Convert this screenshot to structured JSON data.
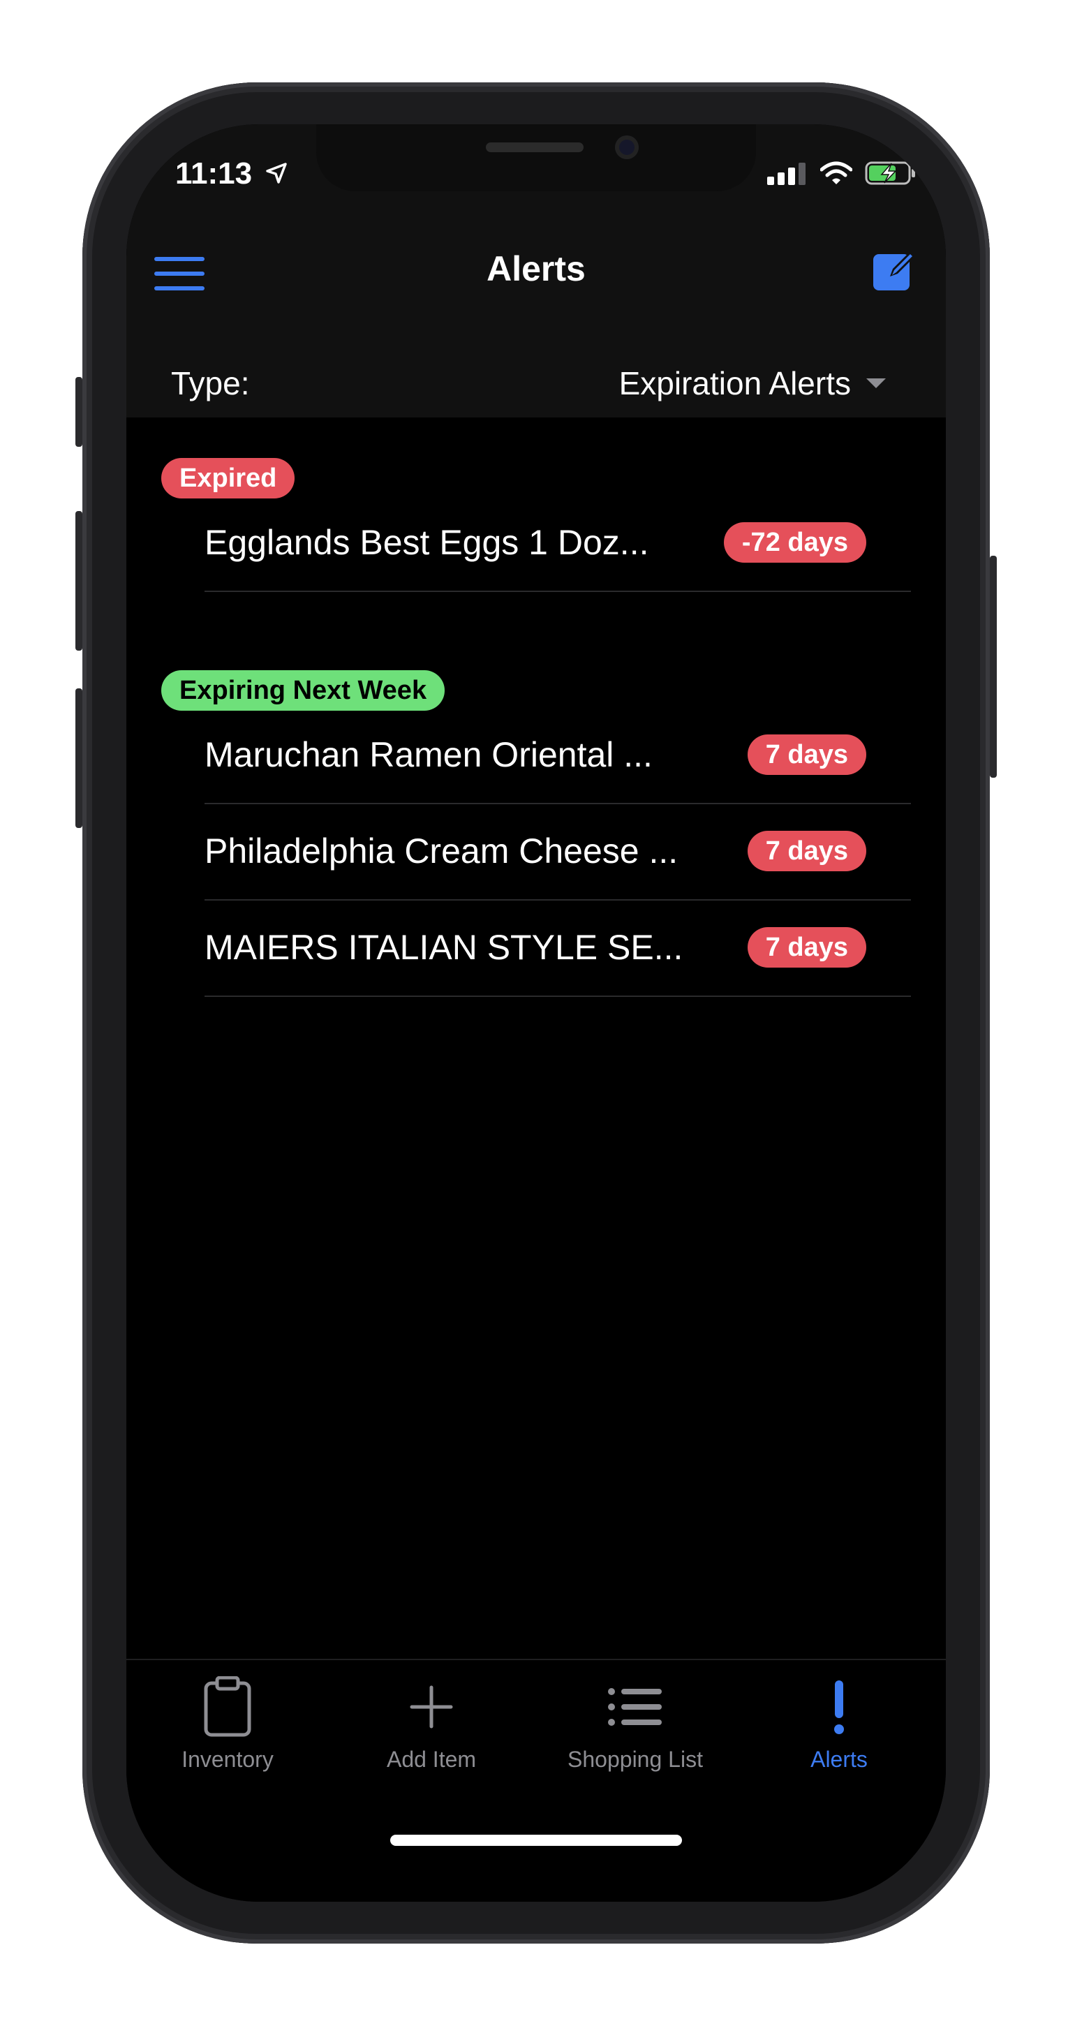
{
  "status_bar": {
    "time": "11:13"
  },
  "nav": {
    "title": "Alerts"
  },
  "filter": {
    "type_label": "Type:",
    "selected_value": "Expiration Alerts"
  },
  "sections": {
    "expired": {
      "label": "Expired",
      "color": "#e5505a",
      "items": [
        {
          "name": "Egglands Best Eggs 1 Doz...",
          "days": "-72 days"
        }
      ]
    },
    "next_week": {
      "label": "Expiring Next Week",
      "color": "#6ee07a",
      "items": [
        {
          "name": "Maruchan Ramen Oriental ...",
          "days": "7 days"
        },
        {
          "name": "Philadelphia Cream Cheese ...",
          "days": "7 days"
        },
        {
          "name": "MAIERS ITALIAN STYLE SE...",
          "days": "7 days"
        }
      ]
    }
  },
  "tabs": [
    {
      "label": "Inventory",
      "icon": "clipboard-icon"
    },
    {
      "label": "Add Item",
      "icon": "plus-icon"
    },
    {
      "label": "Shopping List",
      "icon": "list-icon"
    },
    {
      "label": "Alerts",
      "icon": "exclamation-icon",
      "active": true
    }
  ],
  "colors": {
    "accent": "#3d7cf2",
    "alert_red": "#e5505a",
    "next_week_green": "#6ee07a",
    "inactive_tab": "#8e8e93"
  }
}
